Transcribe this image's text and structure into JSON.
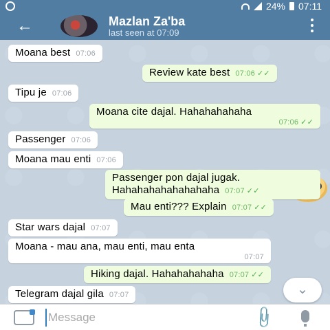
{
  "statusbar": {
    "battery": "24%",
    "time": "07:11"
  },
  "header": {
    "back_icon": "arrow-left-icon",
    "contact_name": "Mazlan Za'ba",
    "last_seen": "last seen at 07:09",
    "menu_icon": "dots-vertical-icon"
  },
  "messages": [
    {
      "dir": "in",
      "text": "Moana best",
      "time": "07:06"
    },
    {
      "dir": "out",
      "text": "Review kate best",
      "time": "07:06"
    },
    {
      "dir": "in",
      "text": "Tipu je",
      "time": "07:06"
    },
    {
      "dir": "out",
      "text": "Moana cite dajal. Hahahahahaha",
      "time": "07:06"
    },
    {
      "dir": "in",
      "text": "Passenger",
      "time": "07:06"
    },
    {
      "dir": "in",
      "text": "Moana mau enti",
      "time": "07:06"
    },
    {
      "dir": "out",
      "text": "Passenger pon dajal jugak.",
      "text2": "Hahahahahahahahaha",
      "time": "07:07"
    },
    {
      "dir": "out",
      "text": "Mau enti??? Explain",
      "time": "07:07"
    },
    {
      "dir": "in",
      "text": "Star wars dajal",
      "time": "07:07"
    },
    {
      "dir": "in",
      "text": "Moana - mau ana, mau enti, mau enta",
      "time": "07:07"
    },
    {
      "dir": "out",
      "text": "Hiking dajal. Hahahahahaha",
      "time": "07:07"
    },
    {
      "dir": "in",
      "text": "Telegram dajal gila",
      "time": "07:07"
    }
  ],
  "sticker": {
    "icon": "nerd-face-emoji"
  },
  "scroll_button": {
    "icon": "chevron-down-icon"
  },
  "composer": {
    "placeholder": "Message",
    "attach_icon": "paperclip-icon",
    "mic_icon": "microphone-icon"
  },
  "colors": {
    "header": "#517da2",
    "incoming": "#ffffff",
    "outgoing": "#effdde",
    "read_check": "#4fae4e"
  }
}
